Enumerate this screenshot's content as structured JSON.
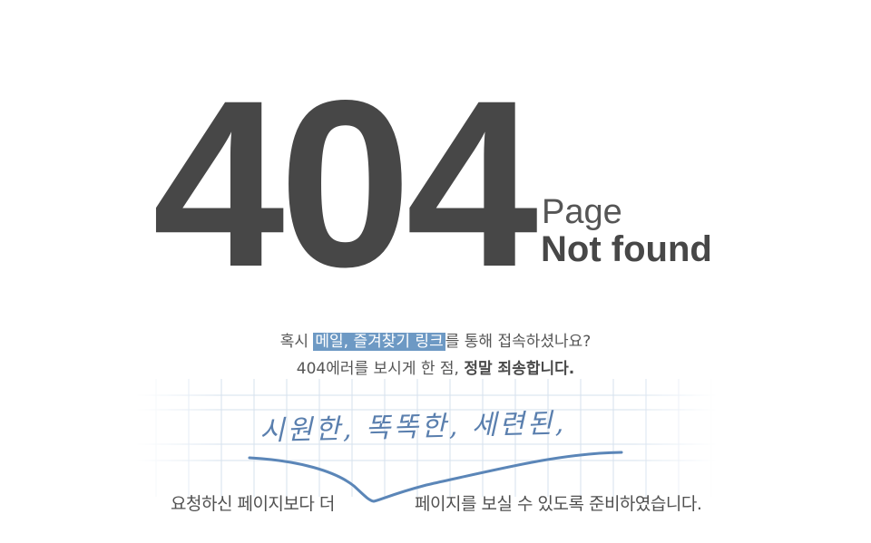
{
  "error": {
    "code": "404",
    "page_word": "Page",
    "not_found_word": "Not found"
  },
  "message": {
    "line1_prefix": "혹시 ",
    "line1_highlight": "메일, 즐겨찾기 링크",
    "line1_suffix": "를 통해 접속하셨나요?",
    "line2_prefix": "404에러를 보시게 한 점, ",
    "line2_strong": "정말 죄송합니다."
  },
  "handwriting": {
    "text": "시원한, 똑똑한, 세련된,"
  },
  "bottom": {
    "left": "요청하신 페이지보다 더",
    "right": "페이지를 보실 수 있도록 준비하였습니다."
  },
  "colors": {
    "accent": "#6d99c4",
    "handwriting": "#5a7fae",
    "big_text": "#474747",
    "grid": "#d6e2ee"
  }
}
